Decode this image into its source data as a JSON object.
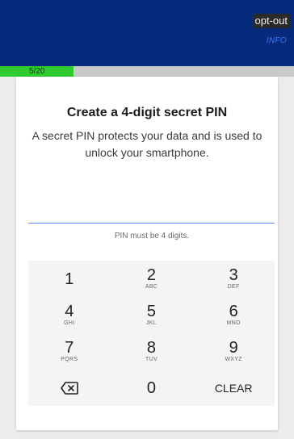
{
  "header": {
    "optout_label": "opt-out",
    "info_label": "INFO"
  },
  "progress": {
    "label": "5/20",
    "fraction": 0.25
  },
  "setup": {
    "title": "Create a 4-digit secret PIN",
    "description": "A secret PIN protects your data and is used to unlock your smartphone.",
    "pin_value": "",
    "hint": "PIN must be 4 digits."
  },
  "keypad": {
    "keys": [
      {
        "num": "1",
        "letters": ""
      },
      {
        "num": "2",
        "letters": "ABC"
      },
      {
        "num": "3",
        "letters": "DEF"
      },
      {
        "num": "4",
        "letters": "GHI"
      },
      {
        "num": "5",
        "letters": "JKL"
      },
      {
        "num": "6",
        "letters": "MNO"
      },
      {
        "num": "7",
        "letters": "PQRS"
      },
      {
        "num": "8",
        "letters": "TUV"
      },
      {
        "num": "9",
        "letters": "WXYZ"
      }
    ],
    "zero": "0",
    "clear_label": "CLEAR",
    "backspace_icon": "backspace-icon"
  },
  "colors": {
    "header_bg": "#062a7c",
    "progress_fill": "#2ecc2e",
    "accent_line": "#5b8ff0"
  }
}
